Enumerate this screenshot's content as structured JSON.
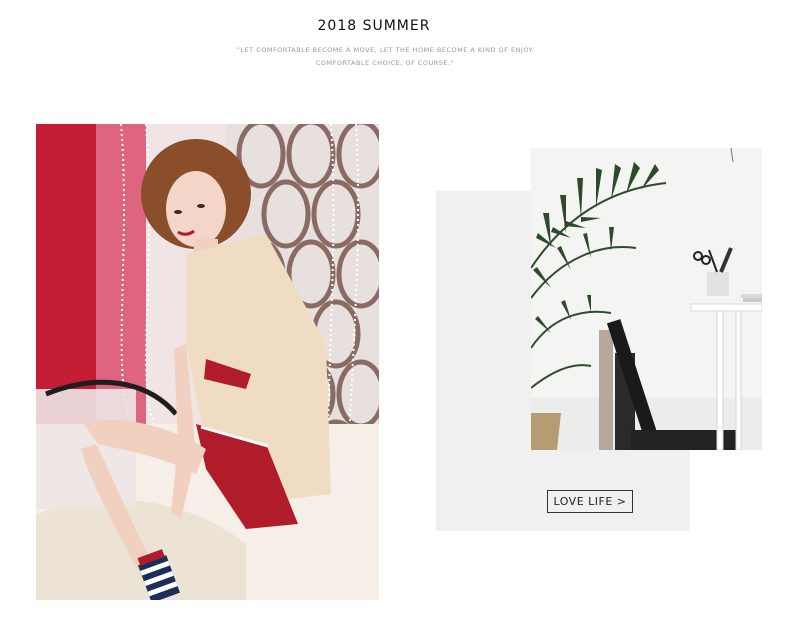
{
  "header": {
    "title": "2018 SUMMER",
    "subtitle_line1": "\"LET COMFORTABLE BECOME A MOVE, LET THE HOME BECOME A KIND OF ENJOY",
    "subtitle_line2": "COMFORTABLE CHOICE, OF COURSE.\""
  },
  "feature": {
    "cta_label": "LOVE LIFE >"
  },
  "colors": {
    "background": "#ffffff",
    "panel_gray": "#f0f0f0",
    "accent_red": "#b01c2a"
  }
}
